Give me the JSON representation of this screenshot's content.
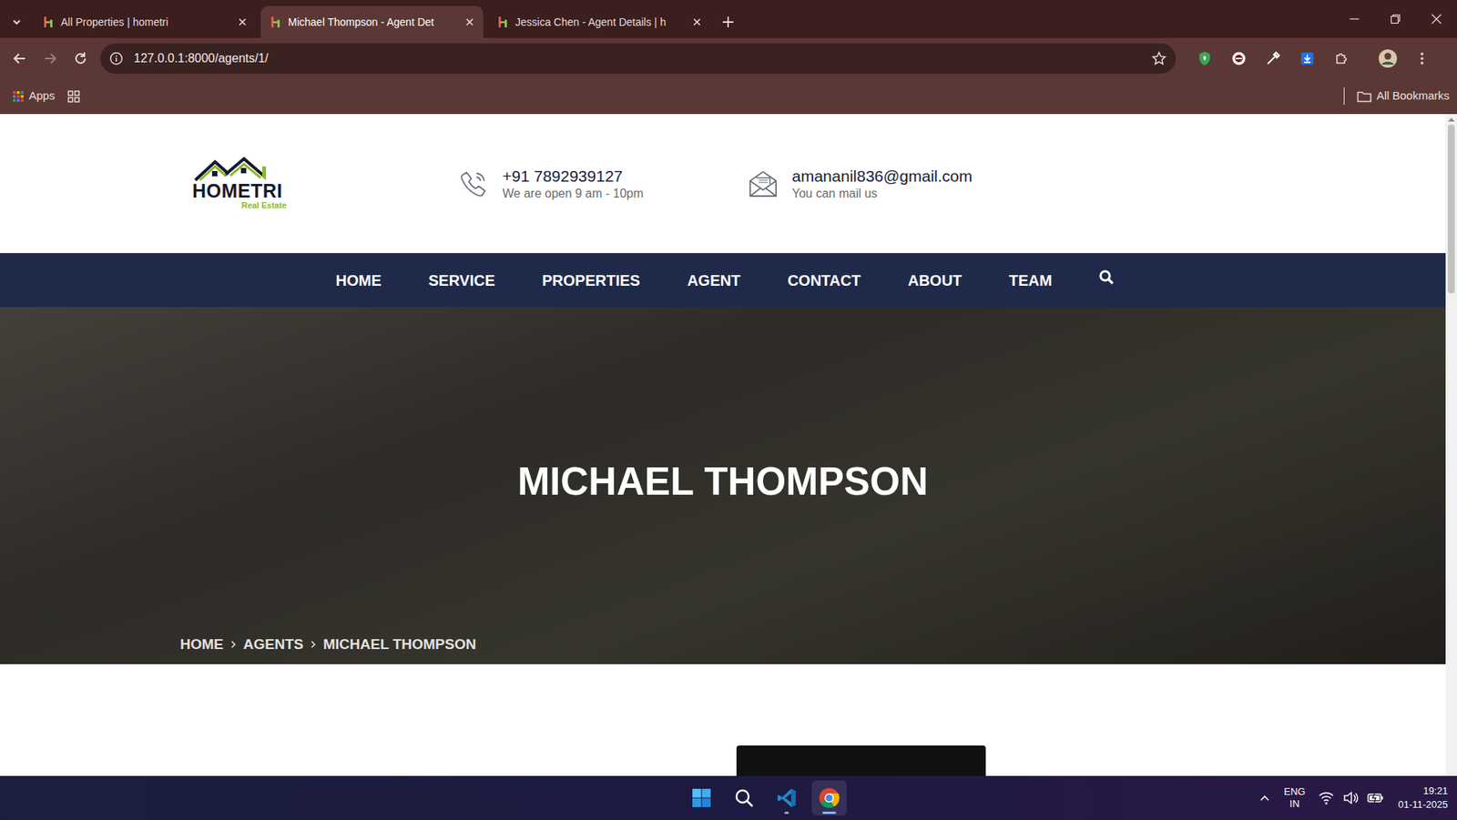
{
  "browser": {
    "tabs": [
      {
        "label": "All Properties | hometri",
        "selected": false
      },
      {
        "label": "Michael Thompson - Agent Det",
        "selected": true
      },
      {
        "label": "Jessica Chen - Agent Details | h",
        "selected": false
      }
    ],
    "address": "127.0.0.1:8000/agents/1/",
    "bookmarks": {
      "apps": "Apps",
      "all": "All Bookmarks"
    }
  },
  "page": {
    "logo": {
      "name": "HOMETRI",
      "tagline": "Real Estate"
    },
    "contacts": [
      {
        "kind": "phone",
        "title": "+91 7892939127",
        "subtitle": "We are open 9 am - 10pm"
      },
      {
        "kind": "email",
        "title": "amananil836@gmail.com",
        "subtitle": "You can mail us"
      }
    ],
    "nav": [
      "HOME",
      "SERVICE",
      "PROPERTIES",
      "AGENT",
      "CONTACT",
      "ABOUT",
      "TEAM"
    ],
    "hero": {
      "title": "MICHAEL THOMPSON"
    },
    "breadcrumb": [
      "HOME",
      "AGENTS",
      "MICHAEL THOMPSON"
    ],
    "scroll": {
      "level": 0.26
    }
  },
  "taskbar": {
    "apps": [
      {
        "kind": "start",
        "running": false,
        "active": false
      },
      {
        "kind": "search",
        "running": false,
        "active": false
      },
      {
        "kind": "vscode",
        "running": true,
        "active": false
      },
      {
        "kind": "chrome",
        "running": true,
        "active": true
      }
    ],
    "language": "ENG",
    "region": "IN",
    "time": "19:21",
    "date": "01-11-2025"
  }
}
